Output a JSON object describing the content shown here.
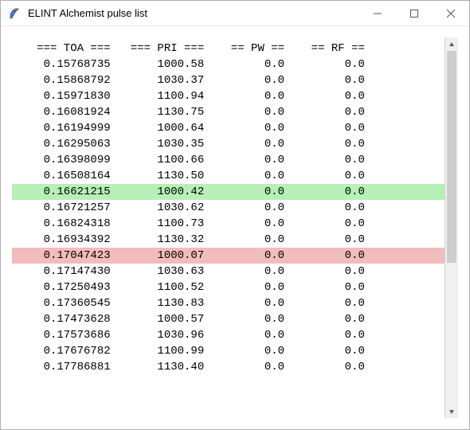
{
  "window": {
    "title": "ELINT Alchemist pulse list",
    "icon": "tk-feather-icon"
  },
  "header": {
    "toa": "=== TOA ===",
    "pri": "=== PRI ===",
    "pw": "== PW ==",
    "rf": "== RF =="
  },
  "rows": [
    {
      "toa": "0.15768735",
      "pri": "1000.58",
      "pw": "0.0",
      "rf": "0.0",
      "hl": null
    },
    {
      "toa": "0.15868792",
      "pri": "1030.37",
      "pw": "0.0",
      "rf": "0.0",
      "hl": null
    },
    {
      "toa": "0.15971830",
      "pri": "1100.94",
      "pw": "0.0",
      "rf": "0.0",
      "hl": null
    },
    {
      "toa": "0.16081924",
      "pri": "1130.75",
      "pw": "0.0",
      "rf": "0.0",
      "hl": null
    },
    {
      "toa": "0.16194999",
      "pri": "1000.64",
      "pw": "0.0",
      "rf": "0.0",
      "hl": null
    },
    {
      "toa": "0.16295063",
      "pri": "1030.35",
      "pw": "0.0",
      "rf": "0.0",
      "hl": null
    },
    {
      "toa": "0.16398099",
      "pri": "1100.66",
      "pw": "0.0",
      "rf": "0.0",
      "hl": null
    },
    {
      "toa": "0.16508164",
      "pri": "1130.50",
      "pw": "0.0",
      "rf": "0.0",
      "hl": null
    },
    {
      "toa": "0.16621215",
      "pri": "1000.42",
      "pw": "0.0",
      "rf": "0.0",
      "hl": "green"
    },
    {
      "toa": "0.16721257",
      "pri": "1030.62",
      "pw": "0.0",
      "rf": "0.0",
      "hl": null
    },
    {
      "toa": "0.16824318",
      "pri": "1100.73",
      "pw": "0.0",
      "rf": "0.0",
      "hl": null
    },
    {
      "toa": "0.16934392",
      "pri": "1130.32",
      "pw": "0.0",
      "rf": "0.0",
      "hl": null
    },
    {
      "toa": "0.17047423",
      "pri": "1000.07",
      "pw": "0.0",
      "rf": "0.0",
      "hl": "red"
    },
    {
      "toa": "0.17147430",
      "pri": "1030.63",
      "pw": "0.0",
      "rf": "0.0",
      "hl": null
    },
    {
      "toa": "0.17250493",
      "pri": "1100.52",
      "pw": "0.0",
      "rf": "0.0",
      "hl": null
    },
    {
      "toa": "0.17360545",
      "pri": "1130.83",
      "pw": "0.0",
      "rf": "0.0",
      "hl": null
    },
    {
      "toa": "0.17473628",
      "pri": "1000.57",
      "pw": "0.0",
      "rf": "0.0",
      "hl": null
    },
    {
      "toa": "0.17573686",
      "pri": "1030.96",
      "pw": "0.0",
      "rf": "0.0",
      "hl": null
    },
    {
      "toa": "0.17676782",
      "pri": "1100.99",
      "pw": "0.0",
      "rf": "0.0",
      "hl": null
    },
    {
      "toa": "0.17786881",
      "pri": "1130.40",
      "pw": "0.0",
      "rf": "0.0",
      "hl": null
    }
  ],
  "col_widths": {
    "toa": 14,
    "pri": 14,
    "pw": 12,
    "rf": 12
  },
  "colors": {
    "highlight_green": "#b6f0b6",
    "highlight_red": "#f3bcbc"
  }
}
